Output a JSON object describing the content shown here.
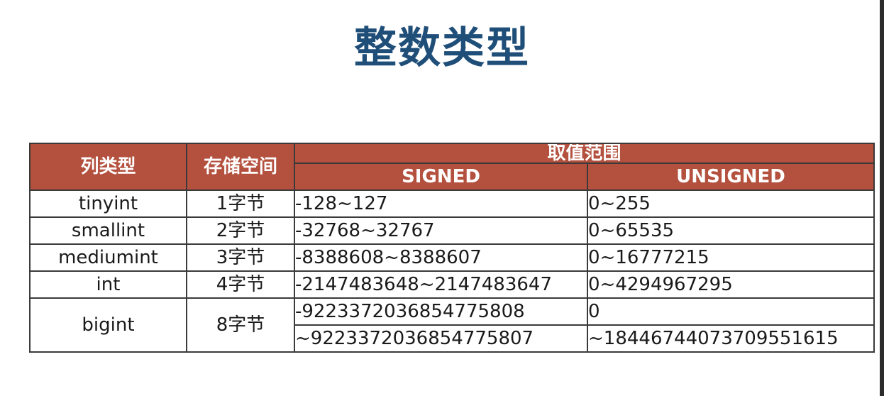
{
  "slide": {
    "title": "整数类型"
  },
  "table": {
    "headers": {
      "col_type": "列类型",
      "storage": "存储空间",
      "range": "取值范围",
      "signed": "SIGNED",
      "unsigned": "UNSIGNED"
    },
    "rows": [
      {
        "type": "tinyint",
        "storage": "1字节",
        "signed": "-128~127",
        "unsigned": "0~255"
      },
      {
        "type": "smallint",
        "storage": "2字节",
        "signed": "-32768~32767",
        "unsigned": "0~65535"
      },
      {
        "type": "mediumint",
        "storage": "3字节",
        "signed": "-8388608~8388607",
        "unsigned": "0~16777215"
      },
      {
        "type": "int",
        "storage": "4字节",
        "signed": "-2147483648~2147483647",
        "unsigned": "0~4294967295"
      },
      {
        "type": "bigint",
        "storage": "8字节",
        "signed_line1": "-9223372036854775808",
        "signed_line2": "~9223372036854775807",
        "unsigned_line1": "0",
        "unsigned_line2": "~18446744073709551615"
      }
    ]
  },
  "colors": {
    "title": "#1f4e79",
    "header_bg": "#b4503e",
    "header_text": "#ffffff"
  }
}
